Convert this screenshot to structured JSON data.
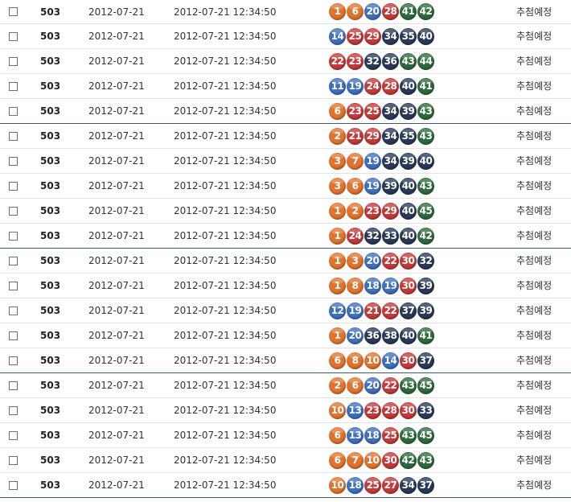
{
  "status_label": "추첨예정",
  "colors": {
    "orange": "#e0742f",
    "blue": "#3f6fbe",
    "red": "#c33a3a",
    "navy": "#2a3957",
    "green": "#2e6a3b",
    "group_divider": "#3b5a82"
  },
  "rows": [
    {
      "round": "503",
      "date": "2012-07-21",
      "time": "2012-07-21 12:34:50",
      "balls": [
        "1",
        "6",
        "20",
        "28",
        "41",
        "42"
      ]
    },
    {
      "round": "503",
      "date": "2012-07-21",
      "time": "2012-07-21 12:34:50",
      "balls": [
        "14",
        "25",
        "29",
        "34",
        "35",
        "40"
      ]
    },
    {
      "round": "503",
      "date": "2012-07-21",
      "time": "2012-07-21 12:34:50",
      "balls": [
        "22",
        "23",
        "32",
        "36",
        "43",
        "44"
      ]
    },
    {
      "round": "503",
      "date": "2012-07-21",
      "time": "2012-07-21 12:34:50",
      "balls": [
        "11",
        "19",
        "24",
        "28",
        "40",
        "41"
      ]
    },
    {
      "round": "503",
      "date": "2012-07-21",
      "time": "2012-07-21 12:34:50",
      "balls": [
        "6",
        "23",
        "25",
        "34",
        "39",
        "43"
      ]
    },
    {
      "round": "503",
      "date": "2012-07-21",
      "time": "2012-07-21 12:34:50",
      "balls": [
        "2",
        "21",
        "29",
        "34",
        "35",
        "43"
      ]
    },
    {
      "round": "503",
      "date": "2012-07-21",
      "time": "2012-07-21 12:34:50",
      "balls": [
        "3",
        "7",
        "19",
        "34",
        "39",
        "40"
      ]
    },
    {
      "round": "503",
      "date": "2012-07-21",
      "time": "2012-07-21 12:34:50",
      "balls": [
        "3",
        "6",
        "19",
        "39",
        "40",
        "43"
      ]
    },
    {
      "round": "503",
      "date": "2012-07-21",
      "time": "2012-07-21 12:34:50",
      "balls": [
        "1",
        "2",
        "23",
        "29",
        "40",
        "45"
      ]
    },
    {
      "round": "503",
      "date": "2012-07-21",
      "time": "2012-07-21 12:34:50",
      "balls": [
        "1",
        "24",
        "32",
        "33",
        "40",
        "42"
      ]
    },
    {
      "round": "503",
      "date": "2012-07-21",
      "time": "2012-07-21 12:34:50",
      "balls": [
        "1",
        "3",
        "20",
        "22",
        "30",
        "32"
      ]
    },
    {
      "round": "503",
      "date": "2012-07-21",
      "time": "2012-07-21 12:34:50",
      "balls": [
        "1",
        "8",
        "18",
        "19",
        "30",
        "39"
      ]
    },
    {
      "round": "503",
      "date": "2012-07-21",
      "time": "2012-07-21 12:34:50",
      "balls": [
        "12",
        "19",
        "21",
        "22",
        "37",
        "39"
      ]
    },
    {
      "round": "503",
      "date": "2012-07-21",
      "time": "2012-07-21 12:34:50",
      "balls": [
        "1",
        "20",
        "36",
        "38",
        "40",
        "41"
      ]
    },
    {
      "round": "503",
      "date": "2012-07-21",
      "time": "2012-07-21 12:34:50",
      "balls": [
        "6",
        "8",
        "10",
        "14",
        "30",
        "37"
      ]
    },
    {
      "round": "503",
      "date": "2012-07-21",
      "time": "2012-07-21 12:34:50",
      "balls": [
        "2",
        "6",
        "20",
        "22",
        "43",
        "45"
      ]
    },
    {
      "round": "503",
      "date": "2012-07-21",
      "time": "2012-07-21 12:34:50",
      "balls": [
        "10",
        "13",
        "23",
        "28",
        "30",
        "33"
      ]
    },
    {
      "round": "503",
      "date": "2012-07-21",
      "time": "2012-07-21 12:34:50",
      "balls": [
        "6",
        "13",
        "18",
        "25",
        "43",
        "45"
      ]
    },
    {
      "round": "503",
      "date": "2012-07-21",
      "time": "2012-07-21 12:34:50",
      "balls": [
        "6",
        "7",
        "10",
        "30",
        "42",
        "43"
      ]
    },
    {
      "round": "503",
      "date": "2012-07-21",
      "time": "2012-07-21 12:34:50",
      "balls": [
        "10",
        "18",
        "25",
        "27",
        "34",
        "37"
      ]
    }
  ]
}
